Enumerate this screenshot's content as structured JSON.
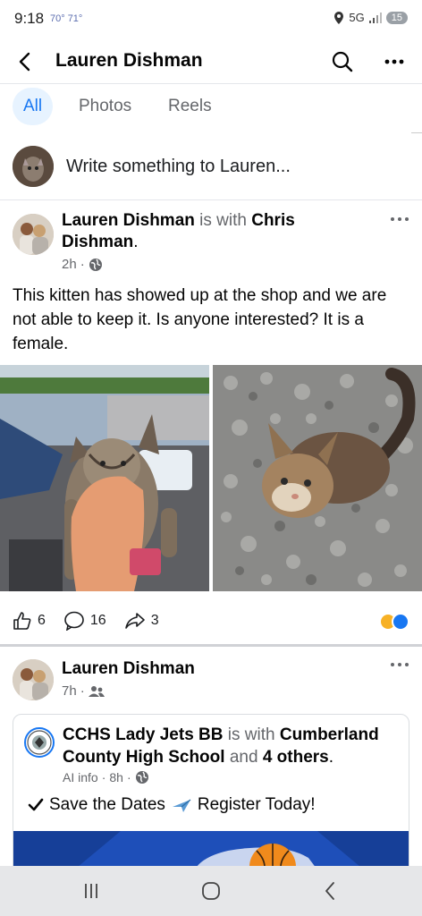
{
  "status": {
    "time": "9:18",
    "temps": "70° 71°",
    "network": "5G",
    "battery": "15"
  },
  "nav": {
    "title": "Lauren Dishman"
  },
  "tabs": [
    {
      "label": "All",
      "active": true
    },
    {
      "label": "Photos",
      "active": false
    },
    {
      "label": "Reels",
      "active": false
    }
  ],
  "composer": {
    "placeholder": "Write something to Lauren..."
  },
  "post1": {
    "author": "Lauren Dishman",
    "connector": " is with ",
    "with": "Chris Dishman",
    "period": ".",
    "time": "2h",
    "audience_icon": "globe-icon",
    "body": "This kitten has showed up at the shop and we are not able to keep it. Is anyone interested? It is a female.",
    "likes": "6",
    "comments": "16",
    "shares": "3"
  },
  "post2": {
    "author": "Lauren Dishman",
    "time": "7h",
    "audience_icon": "friends-icon",
    "shared": {
      "page": "CCHS Lady Jets BB",
      "connector": " is with ",
      "with": "Cumberland County High School",
      "and": " and ",
      "others": "4 others",
      "period": ".",
      "meta_label": "AI info",
      "time": "8h",
      "text_pre": "Save the Dates",
      "text_post": "Register Today!"
    }
  },
  "colors": {
    "accent": "#1877f2",
    "tab_active_bg": "#e7f3ff",
    "muted": "#65676b"
  }
}
